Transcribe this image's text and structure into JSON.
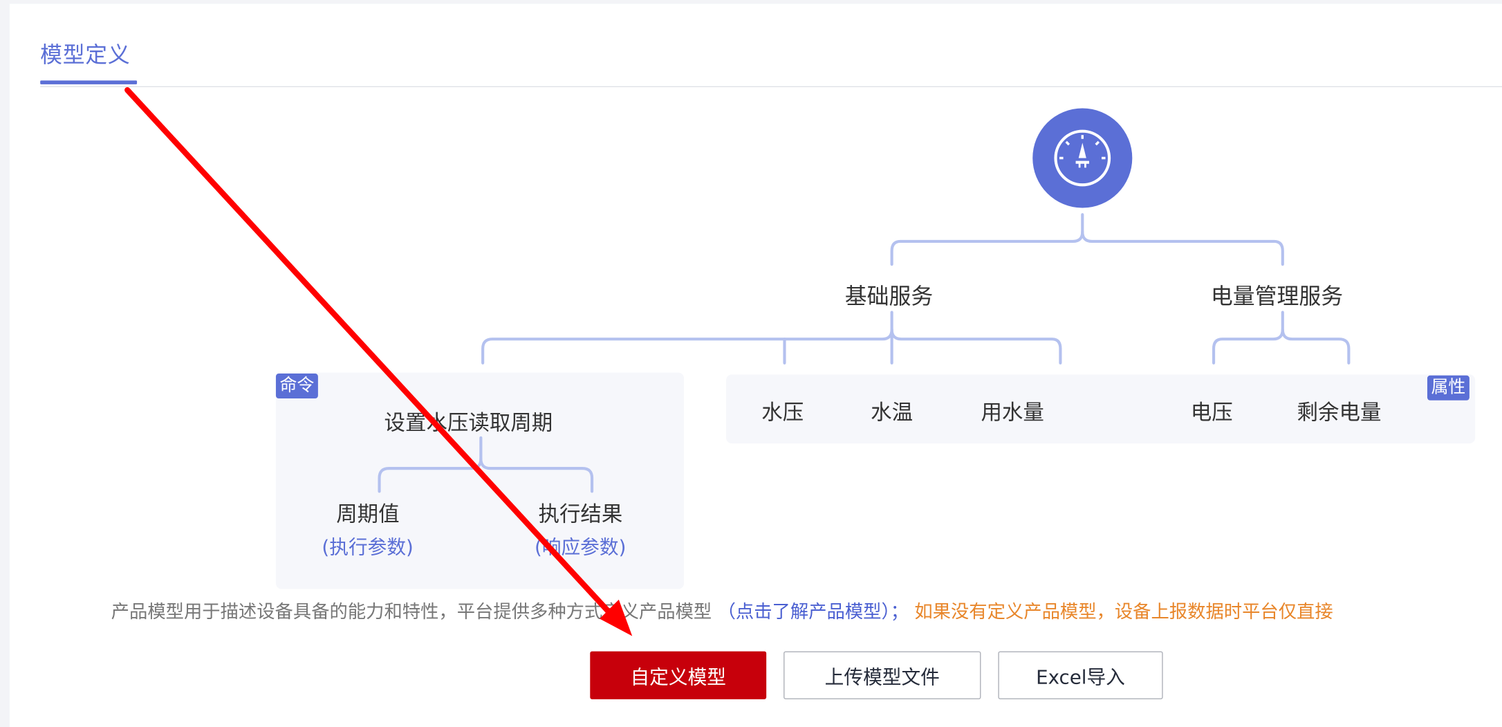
{
  "tab": {
    "label": "模型定义"
  },
  "tree": {
    "root_icon": "gauge-icon",
    "services": [
      {
        "label": "基础服务"
      },
      {
        "label": "电量管理服务"
      }
    ],
    "command_card": {
      "badge": "命令",
      "title": "设置水压读取周期",
      "params": [
        {
          "name": "周期值",
          "type": "(执行参数)"
        },
        {
          "name": "执行结果",
          "type": "(响应参数)"
        }
      ]
    },
    "property_card": {
      "badge": "属性",
      "items": [
        "水压",
        "水温",
        "用水量",
        "电压",
        "剩余电量"
      ]
    }
  },
  "description": {
    "text": "产品模型用于描述设备具备的能力和特性，平台提供多种方式定义产品模型",
    "link": "（点击了解产品模型）；",
    "warning": "如果没有定义产品模型，设备上报数据时平台仅直接"
  },
  "buttons": {
    "custom": "自定义模型",
    "upload": "上传模型文件",
    "excel": "Excel导入"
  },
  "colors": {
    "accent": "#5b6fd6",
    "primary_button": "#c7000b",
    "warning_text": "#e8862a",
    "annotation_arrow": "#ff0000"
  }
}
